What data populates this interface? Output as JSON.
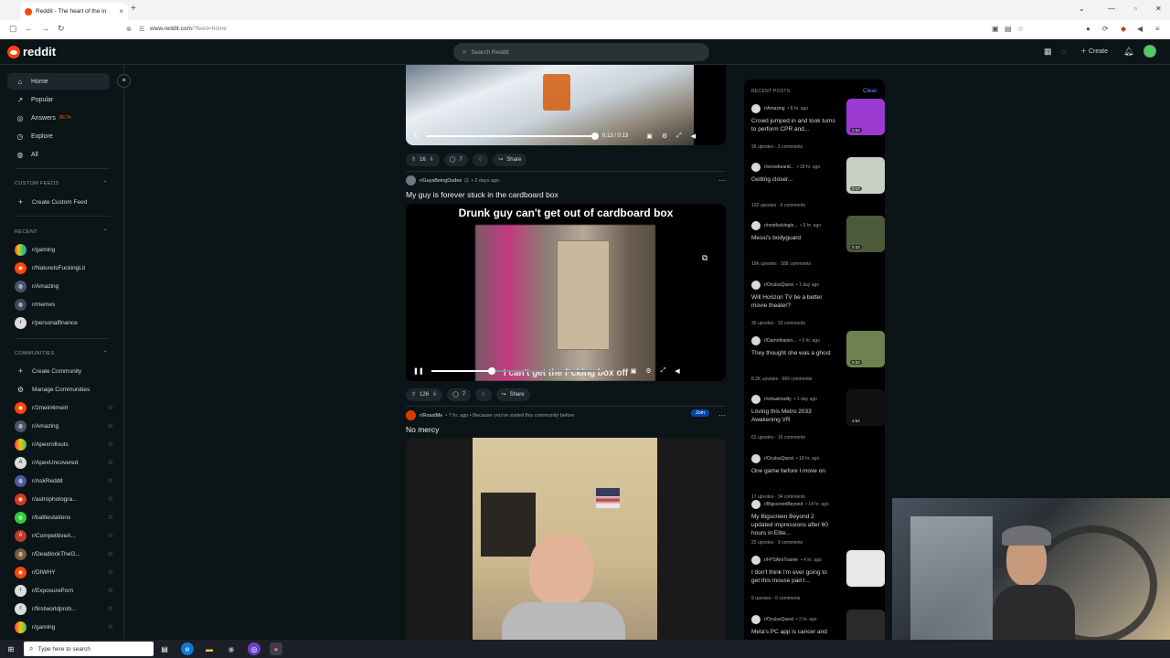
{
  "browser": {
    "tab_title": "Reddit - The heart of the in",
    "url_host": "www.reddit.com",
    "url_path": "/?feed=home"
  },
  "header": {
    "logo": "reddit",
    "search_placeholder": "Search Reddit",
    "create_label": "Create"
  },
  "sidebar": {
    "nav": [
      {
        "label": "Home",
        "icon": "home-icon"
      },
      {
        "label": "Popular",
        "icon": "popular-icon"
      },
      {
        "label": "Answers",
        "icon": "answers-icon",
        "badge": "BETA"
      },
      {
        "label": "Explore",
        "icon": "explore-icon"
      },
      {
        "label": "All",
        "icon": "all-icon"
      }
    ],
    "custom_feeds_heading": "CUSTOM FEEDS",
    "create_custom_feed": "Create Custom Feed",
    "recent_heading": "RECENT",
    "recent": [
      "r/gaming",
      "r/NatureIsFuckingLit",
      "r/Amazing",
      "r/memes",
      "r/personalfinance"
    ],
    "communities_heading": "COMMUNITIES",
    "create_community": "Create Community",
    "manage_communities": "Manage Communities",
    "communities": [
      "r/2meirl4meirl",
      "r/Amazing",
      "r/Apexrollouts",
      "r/ApexUncovered",
      "r/AskReddit",
      "r/astrophotogra...",
      "r/battlestations",
      "r/CompetitiveA...",
      "r/DeadlockTheG...",
      "r/DIWHY",
      "r/ExposurePorn",
      "r/firstworldprob...",
      "r/gaming"
    ]
  },
  "feed": {
    "post1": {
      "time": "0:13 / 0:13",
      "progress": 1.0,
      "votes": "16",
      "comments": "7",
      "share": "Share"
    },
    "post2": {
      "sub": "r/GuysBeingDudes",
      "age": "• 2 days ago",
      "title": "My guy is forever stuck in the cardboard box",
      "overlay_title": "Drunk guy can't get out of cardboard box",
      "subtitle": "I can't get the f*cking box off",
      "progress": 0.35,
      "votes": "126",
      "comments": "7",
      "share": "Share"
    },
    "post3": {
      "sub": "r/RoastMe",
      "age": "• 7 hr. ago • Because you've visited this community before",
      "join": "Join",
      "title": "No mercy"
    }
  },
  "recent_posts": {
    "heading": "RECENT POSTS",
    "clear": "Clear",
    "items": [
      {
        "sub": "r/Amazing",
        "age": "• 8 hr. ago",
        "title": "Crowd jumped in and took turns to perform CPR and...",
        "stats": "36 upvotes · 2 comments",
        "dur": "2:54",
        "color": "#9b3bd1"
      },
      {
        "sub": "r/snowboardi...",
        "age": "• 18 hr. ago",
        "title": "Getting closer...",
        "stats": "102 upvotes · 6 comments",
        "dur": "0:17",
        "color": "#c8d0c4"
      },
      {
        "sub": "r/nextfuckingle...",
        "age": "• 5 hr. ago",
        "title": "Messi's bodyguard",
        "stats": "19K upvotes · 588 comments",
        "dur": "0:33",
        "color": "#4c5a3a"
      },
      {
        "sub": "r/OculusQuest",
        "age": "• 1 day ago",
        "title": "Will Horizon TV be a better movie theater?",
        "stats": "35 upvotes · 33 comments",
        "dur": "",
        "color": ""
      },
      {
        "sub": "r/Damnthatsin...",
        "age": "• 5 hr. ago",
        "title": "They thought she was a ghost",
        "stats": "8.2K upvotes · 660 comments",
        "dur": "0:32",
        "color": "#6d8250"
      },
      {
        "sub": "r/virtualreality",
        "age": "• 1 day ago",
        "title": "Loving this Metro 2033 Awakening VR",
        "stats": "62 upvotes · 16 comments",
        "dur": "2:54",
        "color": "#111"
      },
      {
        "sub": "r/OculusQuest",
        "age": "• 18 hr. ago",
        "title": "One game before I move on",
        "stats": "17 upvotes · 34 comments",
        "dur": "",
        "color": ""
      },
      {
        "sub": "r/BigscreenBeyond",
        "age": "• 14 hr. ago",
        "title": "My Bigscreen Beyond 2 updated impressions after 60 hours in Elite...",
        "stats": "25 upvotes · 9 comments",
        "dur": "",
        "color": ""
      },
      {
        "sub": "r/FPSAimTrainer",
        "age": "• 4 hr. ago",
        "title": "I don't think I'm ever going to get this mouse pad I...",
        "stats": "9 upvotes · 6 comments",
        "dur": "",
        "color": "#e8e8e8"
      },
      {
        "sub": "r/OculusQuest",
        "age": "• 2 hr. ago",
        "title": "Meta's PC app is cancer and",
        "stats": "",
        "dur": "",
        "color": "#2a2a2a"
      }
    ]
  },
  "taskbar": {
    "search_placeholder": "Type here to search"
  }
}
